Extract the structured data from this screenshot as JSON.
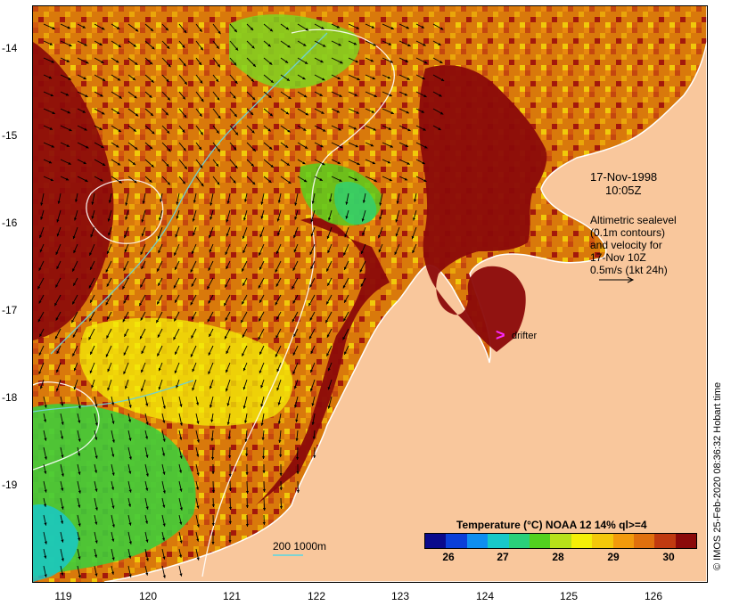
{
  "map": {
    "lon_range": [
      118.65,
      126.7
    ],
    "lat_range": [
      -20.1,
      -13.6
    ],
    "x_ticks": [
      "119",
      "120",
      "121",
      "122",
      "123",
      "124",
      "125",
      "126"
    ],
    "y_ticks": [
      "-14",
      "-15",
      "-16",
      "-17",
      "-18",
      "-19"
    ],
    "land_color": "#f9c79c",
    "velocity_arrow_color": "#000000",
    "sealevel_contour_color": "#ffffff",
    "depth_contour_color": "#6fd0d0"
  },
  "annotations": {
    "date": "17-Nov-1998",
    "time": "10:05Z",
    "legend_lines": [
      "Altimetric sealevel",
      "(0.1m contours)",
      "and velocity for",
      "17-Nov 10Z",
      "0.5m/s (1kt 24h)"
    ],
    "drifter_symbol": ">",
    "drifter_label": "drifter",
    "scale_label": "200  1000m",
    "credit": "© IMOS 25-Feb-2020 08:36:32 Hobart time"
  },
  "colorbar": {
    "title": "Temperature (°C) NOAA 12 14% ql>=4",
    "tick_labels": [
      "26",
      "27",
      "28",
      "29",
      "30"
    ],
    "colors": [
      "#0a0a8c",
      "#0b3fd8",
      "#0f8ef0",
      "#18c8c8",
      "#2bd07a",
      "#52d11f",
      "#b7e11a",
      "#f4ef08",
      "#f4c80a",
      "#f29a0c",
      "#e0700e",
      "#c03a10",
      "#8b0a0a"
    ]
  }
}
